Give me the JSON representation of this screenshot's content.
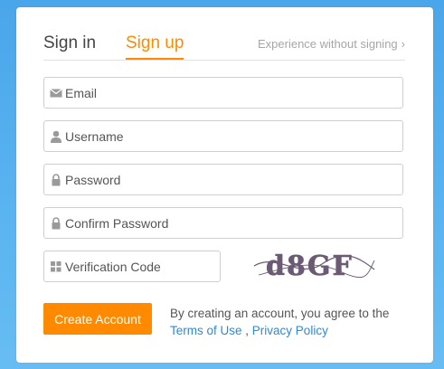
{
  "tabs": {
    "sign_in": "Sign in",
    "sign_up": "Sign up",
    "guest_link": "Experience without signing",
    "guest_chevron": "›"
  },
  "form": {
    "email_placeholder": "Email",
    "username_placeholder": "Username",
    "password_placeholder": "Password",
    "confirm_password_placeholder": "Confirm Password",
    "verification_placeholder": "Verification Code",
    "captcha_text": "d8GF",
    "create_button": "Create Account"
  },
  "terms": {
    "prefix": "By creating an account, you agree to the",
    "terms_link": "Terms of Use",
    "separator": " , ",
    "privacy_link": "Privacy Policy"
  },
  "icons": {
    "email": "envelope-icon",
    "username": "user-icon",
    "password": "lock-icon",
    "confirm": "lock-icon",
    "verification": "grid-icon"
  },
  "colors": {
    "accent": "#ff8a00",
    "link": "#2a8bd8",
    "background": "#4aa6ea"
  }
}
